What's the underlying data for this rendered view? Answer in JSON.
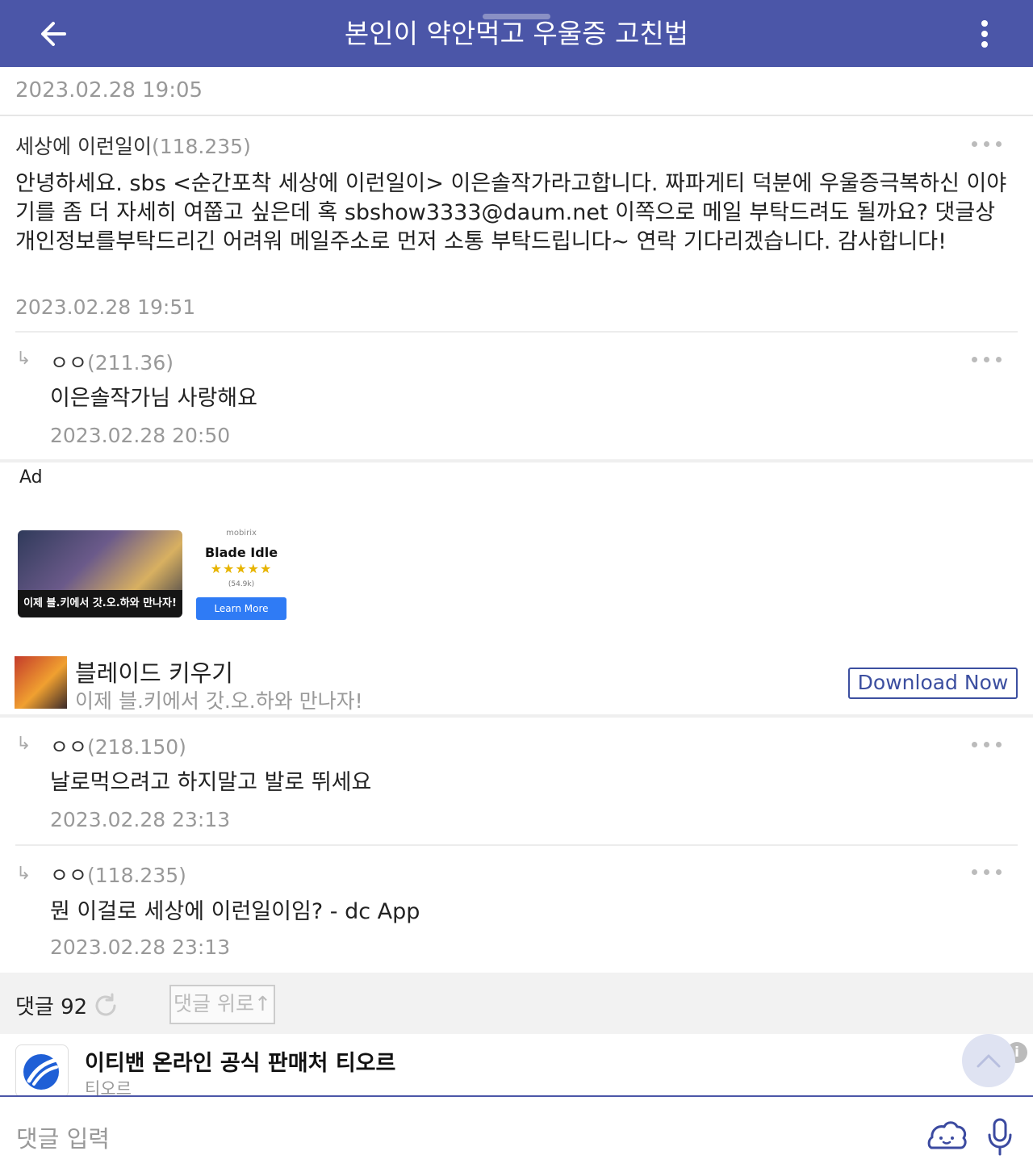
{
  "header": {
    "title": "본인이 약안먹고 우울증 고친법"
  },
  "post_date": "2023.02.28 19:05",
  "comments": [
    {
      "author": "세상에 이런일이",
      "ip": "(118.235)",
      "text": "안녕하세요. sbs <순간포착 세상에 이런일이> 이은솔작가라고합니다. 짜파게티 덕분에 우울증극복하신 이야기를 좀 더 자세히 여쭙고 싶은데 혹 sbshow3333@daum.net 이쪽으로 메일 부탁드려도 될까요? 댓글상 개인정보를부탁드리긴 어려워 메일주소로 먼저 소통 부탁드립니다~ 연락 기다리겠습니다. 감사합니다!",
      "date": "2023.02.28 19:51"
    },
    {
      "author": "ㅇㅇ",
      "ip": "(211.36)",
      "text": "이은솔작가님 사랑해요",
      "date": "2023.02.28 20:50"
    },
    {
      "author": "ㅇㅇ",
      "ip": "(218.150)",
      "text": "날로먹으려고 하지말고 발로 뛰세요",
      "date": "2023.02.28 23:13"
    },
    {
      "author": "ㅇㅇ",
      "ip": "(118.235)",
      "text": "뭔 이걸로 세상에 이런일이임? - dc App",
      "date": "2023.02.28 23:13"
    }
  ],
  "reply_arrow": "↳",
  "ad": {
    "label": "Ad",
    "banner_text": "이제 블.키에서 갓.오.하와 만나자!",
    "brand": "mobirix",
    "game": "Blade Idle",
    "stars": "★★★★★",
    "rating_count": "(54.9k)",
    "learn_more": "Learn More",
    "app_name": "블레이드 키우기",
    "app_sub": "이제 블.키에서 갓.오.하와 만나자!",
    "download": "Download Now"
  },
  "footer": {
    "count": "댓글 92",
    "up_button": "댓글 위로↑"
  },
  "promo": {
    "title": "이티밴 온라인 공식 판매처 티오르",
    "sub": "티오르",
    "info": "i"
  },
  "input": {
    "placeholder": "댓글 입력"
  },
  "colors": {
    "header_bg": "#4b56a8",
    "download_border": "#3c4fa0",
    "learn_more_bg": "#2f7bf5"
  }
}
